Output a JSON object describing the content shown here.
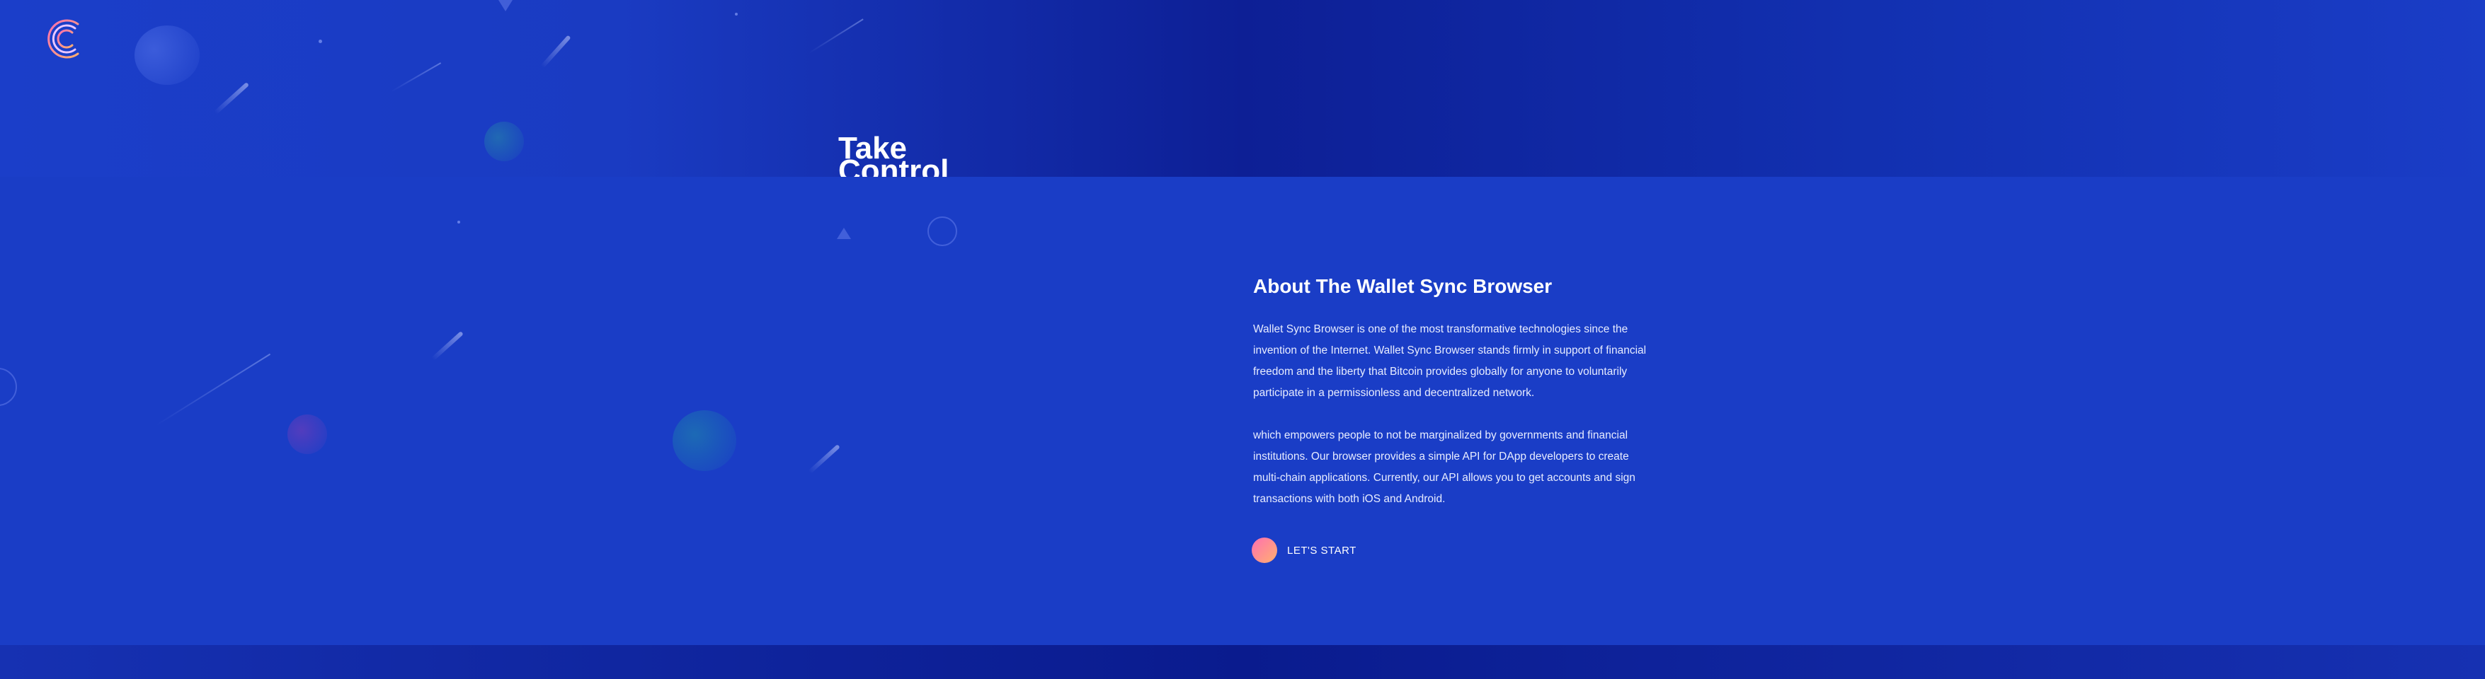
{
  "brand": {
    "logo_icon": "stacked-c-logo-icon",
    "gradient": [
      "#ff6fb1",
      "#ffb070"
    ]
  },
  "hero": {
    "title_lines": [
      "Take",
      "Control"
    ]
  },
  "about": {
    "title": "About The Wallet Sync Browser",
    "paragraph_1": "Wallet Sync Browser is one of the most transformative technologies since the invention of the Internet. Wallet Sync Browser stands firmly in support of financial freedom and the liberty that Bitcoin provides globally for anyone to voluntarily participate in a permissionless and decentralized network.",
    "paragraph_2": "which empowers people to not be marginalized by governments and financial institutions. Our browser provides a simple API for DApp developers to create multi-chain applications. Currently, our API allows you to get accounts and sign transactions with both iOS and Android.",
    "cta_label": "LET'S START"
  },
  "colors": {
    "background": "#1a3dc6",
    "hero_dark": "#0d1f95",
    "text": "#ffffff"
  }
}
